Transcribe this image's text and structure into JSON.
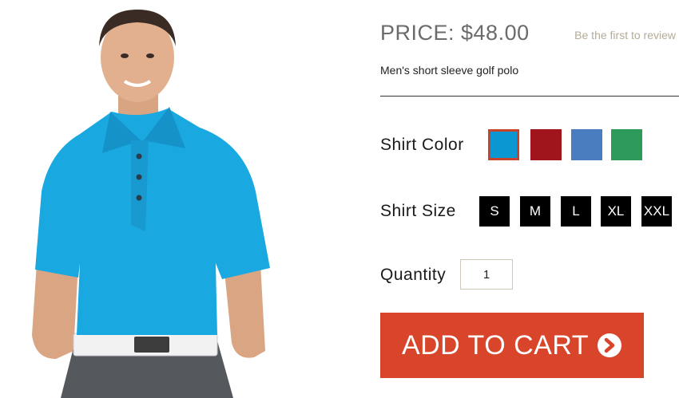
{
  "product": {
    "price_label": "PRICE: $48.00",
    "review_link": "Be the first to review",
    "description": "Men's short sleeve golf polo"
  },
  "options": {
    "color_label": "Shirt Color",
    "colors": [
      {
        "name": "turquoise",
        "hex": "#0b98d2",
        "selected": true
      },
      {
        "name": "red",
        "hex": "#a0141c",
        "selected": false
      },
      {
        "name": "blue",
        "hex": "#4a7cc0",
        "selected": false
      },
      {
        "name": "green",
        "hex": "#2e9a5a",
        "selected": false
      }
    ],
    "selected_color_border": "#c8432b",
    "size_label": "Shirt Size",
    "sizes": [
      "S",
      "M",
      "L",
      "XL",
      "XXL"
    ],
    "quantity_label": "Quantity",
    "quantity_value": "1"
  },
  "cart": {
    "label": "ADD TO CART",
    "color": "#d9452b",
    "icon": "chevron-right-circle-icon"
  },
  "image": {
    "shirt_color": "#1aa8e0"
  }
}
